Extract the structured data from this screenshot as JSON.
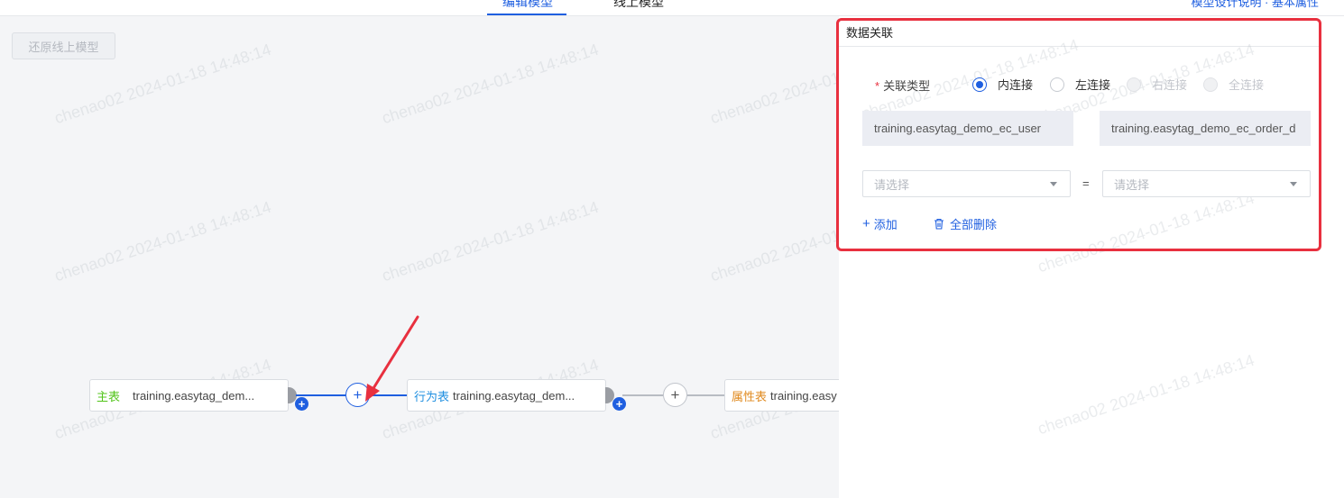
{
  "watermark_text": "chenao02 2024-01-18 14:48:14",
  "canvas": {
    "restore_button": "还原线上模型",
    "nodes": [
      {
        "tag": "主表",
        "tag_color": "#52c41a",
        "name": "training.easytag_dem..."
      },
      {
        "tag": "行为表",
        "tag_color": "#1f8fe0",
        "name": "training.easytag_dem..."
      },
      {
        "tag": "属性表",
        "tag_color": "#e08a1f",
        "name": "training.easy"
      }
    ],
    "add_symbol": "+"
  },
  "panel": {
    "title": "数据关联",
    "join_type_label": "关联类型",
    "join_options": [
      {
        "label": "内连接",
        "state": "checked"
      },
      {
        "label": "左连接",
        "state": "normal"
      },
      {
        "label": "右连接",
        "state": "disabled"
      },
      {
        "label": "全连接",
        "state": "disabled"
      }
    ],
    "left_table": "training.easytag_demo_ec_user",
    "right_table": "training.easytag_demo_ec_order_d",
    "left_field_placeholder": "请选择",
    "right_field_placeholder": "请选择",
    "equals": "=",
    "add_label": "添加",
    "delete_all_label": "全部删除"
  },
  "colors": {
    "accent": "#1f5fe0",
    "highlight": "#e8303f"
  }
}
